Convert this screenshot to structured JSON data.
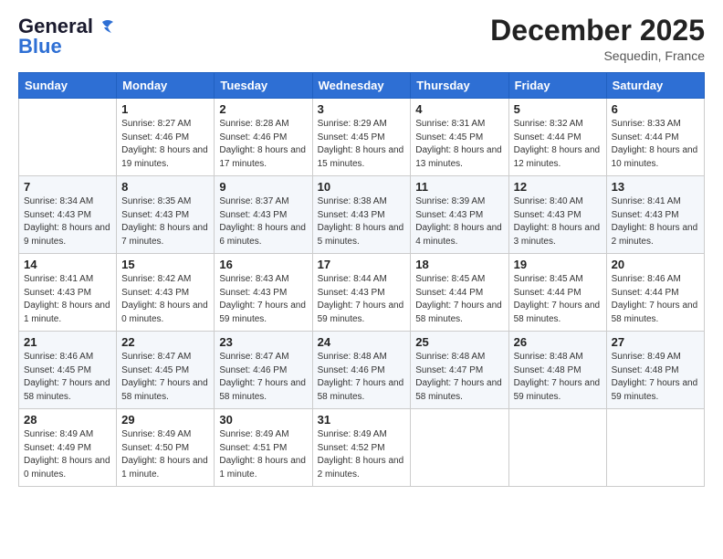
{
  "header": {
    "logo_line1": "General",
    "logo_line2": "Blue",
    "month": "December 2025",
    "location": "Sequedin, France"
  },
  "days_of_week": [
    "Sunday",
    "Monday",
    "Tuesday",
    "Wednesday",
    "Thursday",
    "Friday",
    "Saturday"
  ],
  "weeks": [
    [
      {
        "day": "",
        "sunrise": "",
        "sunset": "",
        "daylight": ""
      },
      {
        "day": "1",
        "sunrise": "Sunrise: 8:27 AM",
        "sunset": "Sunset: 4:46 PM",
        "daylight": "Daylight: 8 hours and 19 minutes."
      },
      {
        "day": "2",
        "sunrise": "Sunrise: 8:28 AM",
        "sunset": "Sunset: 4:46 PM",
        "daylight": "Daylight: 8 hours and 17 minutes."
      },
      {
        "day": "3",
        "sunrise": "Sunrise: 8:29 AM",
        "sunset": "Sunset: 4:45 PM",
        "daylight": "Daylight: 8 hours and 15 minutes."
      },
      {
        "day": "4",
        "sunrise": "Sunrise: 8:31 AM",
        "sunset": "Sunset: 4:45 PM",
        "daylight": "Daylight: 8 hours and 13 minutes."
      },
      {
        "day": "5",
        "sunrise": "Sunrise: 8:32 AM",
        "sunset": "Sunset: 4:44 PM",
        "daylight": "Daylight: 8 hours and 12 minutes."
      },
      {
        "day": "6",
        "sunrise": "Sunrise: 8:33 AM",
        "sunset": "Sunset: 4:44 PM",
        "daylight": "Daylight: 8 hours and 10 minutes."
      }
    ],
    [
      {
        "day": "7",
        "sunrise": "Sunrise: 8:34 AM",
        "sunset": "Sunset: 4:43 PM",
        "daylight": "Daylight: 8 hours and 9 minutes."
      },
      {
        "day": "8",
        "sunrise": "Sunrise: 8:35 AM",
        "sunset": "Sunset: 4:43 PM",
        "daylight": "Daylight: 8 hours and 7 minutes."
      },
      {
        "day": "9",
        "sunrise": "Sunrise: 8:37 AM",
        "sunset": "Sunset: 4:43 PM",
        "daylight": "Daylight: 8 hours and 6 minutes."
      },
      {
        "day": "10",
        "sunrise": "Sunrise: 8:38 AM",
        "sunset": "Sunset: 4:43 PM",
        "daylight": "Daylight: 8 hours and 5 minutes."
      },
      {
        "day": "11",
        "sunrise": "Sunrise: 8:39 AM",
        "sunset": "Sunset: 4:43 PM",
        "daylight": "Daylight: 8 hours and 4 minutes."
      },
      {
        "day": "12",
        "sunrise": "Sunrise: 8:40 AM",
        "sunset": "Sunset: 4:43 PM",
        "daylight": "Daylight: 8 hours and 3 minutes."
      },
      {
        "day": "13",
        "sunrise": "Sunrise: 8:41 AM",
        "sunset": "Sunset: 4:43 PM",
        "daylight": "Daylight: 8 hours and 2 minutes."
      }
    ],
    [
      {
        "day": "14",
        "sunrise": "Sunrise: 8:41 AM",
        "sunset": "Sunset: 4:43 PM",
        "daylight": "Daylight: 8 hours and 1 minute."
      },
      {
        "day": "15",
        "sunrise": "Sunrise: 8:42 AM",
        "sunset": "Sunset: 4:43 PM",
        "daylight": "Daylight: 8 hours and 0 minutes."
      },
      {
        "day": "16",
        "sunrise": "Sunrise: 8:43 AM",
        "sunset": "Sunset: 4:43 PM",
        "daylight": "Daylight: 7 hours and 59 minutes."
      },
      {
        "day": "17",
        "sunrise": "Sunrise: 8:44 AM",
        "sunset": "Sunset: 4:43 PM",
        "daylight": "Daylight: 7 hours and 59 minutes."
      },
      {
        "day": "18",
        "sunrise": "Sunrise: 8:45 AM",
        "sunset": "Sunset: 4:44 PM",
        "daylight": "Daylight: 7 hours and 58 minutes."
      },
      {
        "day": "19",
        "sunrise": "Sunrise: 8:45 AM",
        "sunset": "Sunset: 4:44 PM",
        "daylight": "Daylight: 7 hours and 58 minutes."
      },
      {
        "day": "20",
        "sunrise": "Sunrise: 8:46 AM",
        "sunset": "Sunset: 4:44 PM",
        "daylight": "Daylight: 7 hours and 58 minutes."
      }
    ],
    [
      {
        "day": "21",
        "sunrise": "Sunrise: 8:46 AM",
        "sunset": "Sunset: 4:45 PM",
        "daylight": "Daylight: 7 hours and 58 minutes."
      },
      {
        "day": "22",
        "sunrise": "Sunrise: 8:47 AM",
        "sunset": "Sunset: 4:45 PM",
        "daylight": "Daylight: 7 hours and 58 minutes."
      },
      {
        "day": "23",
        "sunrise": "Sunrise: 8:47 AM",
        "sunset": "Sunset: 4:46 PM",
        "daylight": "Daylight: 7 hours and 58 minutes."
      },
      {
        "day": "24",
        "sunrise": "Sunrise: 8:48 AM",
        "sunset": "Sunset: 4:46 PM",
        "daylight": "Daylight: 7 hours and 58 minutes."
      },
      {
        "day": "25",
        "sunrise": "Sunrise: 8:48 AM",
        "sunset": "Sunset: 4:47 PM",
        "daylight": "Daylight: 7 hours and 58 minutes."
      },
      {
        "day": "26",
        "sunrise": "Sunrise: 8:48 AM",
        "sunset": "Sunset: 4:48 PM",
        "daylight": "Daylight: 7 hours and 59 minutes."
      },
      {
        "day": "27",
        "sunrise": "Sunrise: 8:49 AM",
        "sunset": "Sunset: 4:48 PM",
        "daylight": "Daylight: 7 hours and 59 minutes."
      }
    ],
    [
      {
        "day": "28",
        "sunrise": "Sunrise: 8:49 AM",
        "sunset": "Sunset: 4:49 PM",
        "daylight": "Daylight: 8 hours and 0 minutes."
      },
      {
        "day": "29",
        "sunrise": "Sunrise: 8:49 AM",
        "sunset": "Sunset: 4:50 PM",
        "daylight": "Daylight: 8 hours and 1 minute."
      },
      {
        "day": "30",
        "sunrise": "Sunrise: 8:49 AM",
        "sunset": "Sunset: 4:51 PM",
        "daylight": "Daylight: 8 hours and 1 minute."
      },
      {
        "day": "31",
        "sunrise": "Sunrise: 8:49 AM",
        "sunset": "Sunset: 4:52 PM",
        "daylight": "Daylight: 8 hours and 2 minutes."
      },
      {
        "day": "",
        "sunrise": "",
        "sunset": "",
        "daylight": ""
      },
      {
        "day": "",
        "sunrise": "",
        "sunset": "",
        "daylight": ""
      },
      {
        "day": "",
        "sunrise": "",
        "sunset": "",
        "daylight": ""
      }
    ]
  ]
}
